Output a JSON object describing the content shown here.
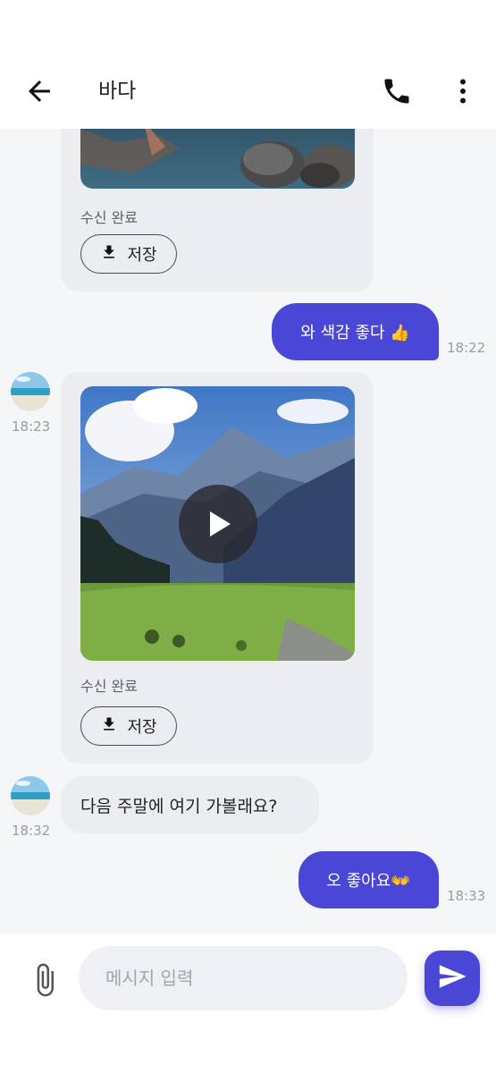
{
  "header": {
    "title": "바다",
    "back_icon": "arrow-left-icon",
    "call_icon": "phone-icon",
    "more_icon": "more-vertical-icon"
  },
  "messages": [
    {
      "type": "received-image-partial",
      "status": "수신 완료",
      "save_label": "저장"
    },
    {
      "type": "sent-text",
      "text": "와 색감 좋다 👍",
      "time": "18:22"
    },
    {
      "type": "received-video",
      "time": "18:23",
      "status": "수신 완료",
      "save_label": "저장"
    },
    {
      "type": "received-text",
      "text": "다음 주말에 여기 가볼래요?",
      "time": "18:32"
    },
    {
      "type": "sent-text",
      "text": "오 좋아요👐",
      "time": "18:33"
    }
  ],
  "composer": {
    "placeholder": "메시지 입력",
    "attach_icon": "paperclip-icon",
    "send_icon": "send-icon"
  },
  "colors": {
    "accent": "#4a47d6",
    "background": "#f5f6f8",
    "bubble_received": "#ecedf1"
  }
}
